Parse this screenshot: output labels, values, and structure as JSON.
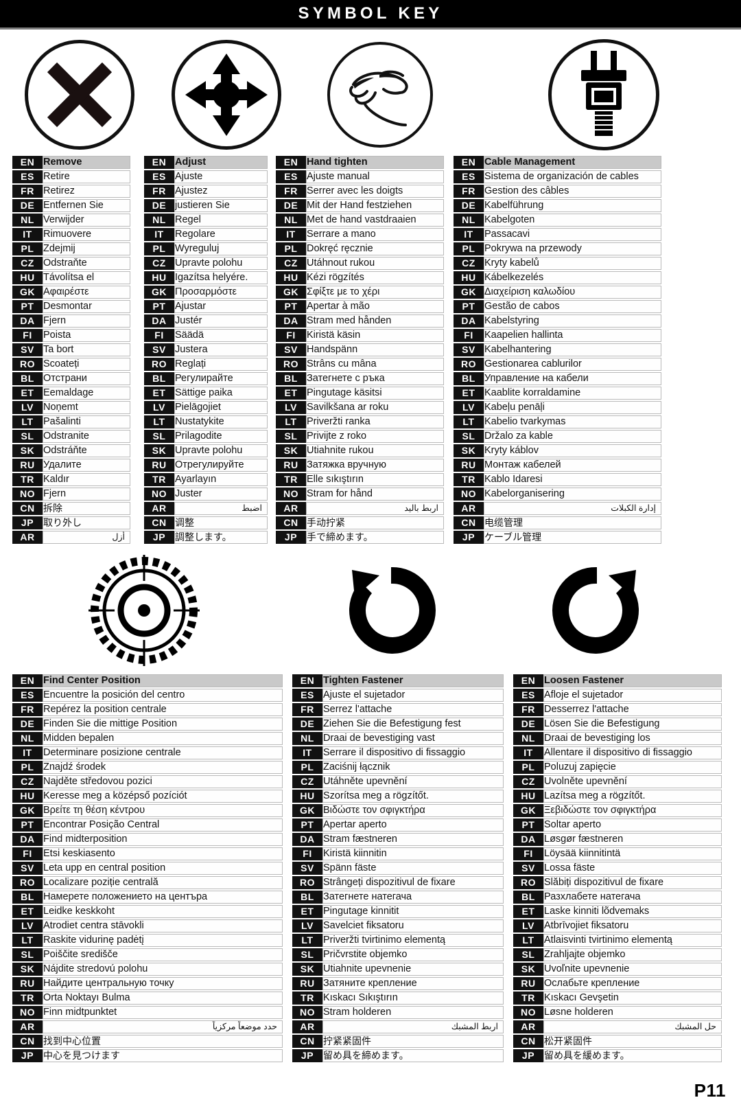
{
  "header": {
    "title": "SYMBOL KEY"
  },
  "footer": {
    "page_number": "P11"
  },
  "icons": {
    "top": [
      {
        "name": "x-cross-icon",
        "meaning": "Remove"
      },
      {
        "name": "four-way-arrows-icon",
        "meaning": "Adjust"
      },
      {
        "name": "hand-pinch-icon",
        "meaning": "Hand tighten"
      },
      {
        "name": "power-plug-icon",
        "meaning": "Cable Management"
      }
    ],
    "bottom": [
      {
        "name": "crosshair-target-icon",
        "meaning": "Find Center Position"
      },
      {
        "name": "clockwise-rotation-arrow-icon",
        "meaning": "Tighten Fastener"
      },
      {
        "name": "counterclockwise-rotation-arrow-icon",
        "meaning": "Loosen Fastener"
      }
    ]
  },
  "tables": {
    "remove": {
      "title": "Remove",
      "rows": [
        {
          "code": "EN",
          "text": "Remove"
        },
        {
          "code": "ES",
          "text": "Retire"
        },
        {
          "code": "FR",
          "text": "Retirez"
        },
        {
          "code": "DE",
          "text": "Entfernen Sie"
        },
        {
          "code": "NL",
          "text": "Verwijder"
        },
        {
          "code": "IT",
          "text": "Rimuovere"
        },
        {
          "code": "PL",
          "text": "Zdejmij"
        },
        {
          "code": "CZ",
          "text": "Odstraňte"
        },
        {
          "code": "HU",
          "text": "Távolítsa el"
        },
        {
          "code": "GK",
          "text": "Αφαιρέστε"
        },
        {
          "code": "PT",
          "text": "Desmontar"
        },
        {
          "code": "DA",
          "text": "Fjern"
        },
        {
          "code": "FI",
          "text": "Poista"
        },
        {
          "code": "SV",
          "text": "Ta bort"
        },
        {
          "code": "RO",
          "text": "Scoateți"
        },
        {
          "code": "BL",
          "text": "Отстрани"
        },
        {
          "code": "ET",
          "text": "Eemaldage"
        },
        {
          "code": "LV",
          "text": "Noņemt"
        },
        {
          "code": "LT",
          "text": "Pašalinti"
        },
        {
          "code": "SL",
          "text": "Odstranite"
        },
        {
          "code": "SK",
          "text": "Odstráňte"
        },
        {
          "code": "RU",
          "text": "Удалите"
        },
        {
          "code": "TR",
          "text": "Kaldır"
        },
        {
          "code": "NO",
          "text": "Fjern"
        },
        {
          "code": "CN",
          "text": "拆除"
        },
        {
          "code": "JP",
          "text": "取り外し"
        },
        {
          "code": "AR",
          "text": "أزل"
        }
      ]
    },
    "adjust": {
      "title": "Adjust",
      "rows": [
        {
          "code": "EN",
          "text": "Adjust"
        },
        {
          "code": "ES",
          "text": "Ajuste"
        },
        {
          "code": "FR",
          "text": "Ajustez"
        },
        {
          "code": "DE",
          "text": "justieren Sie"
        },
        {
          "code": "NL",
          "text": "Regel"
        },
        {
          "code": "IT",
          "text": "Regolare"
        },
        {
          "code": "PL",
          "text": "Wyreguluj"
        },
        {
          "code": "CZ",
          "text": "Upravte polohu"
        },
        {
          "code": "HU",
          "text": "Igazítsa helyére."
        },
        {
          "code": "GK",
          "text": "Προσαρμόστε"
        },
        {
          "code": "PT",
          "text": "Ajustar"
        },
        {
          "code": "DA",
          "text": "Justér"
        },
        {
          "code": "FI",
          "text": "Säädä"
        },
        {
          "code": "SV",
          "text": "Justera"
        },
        {
          "code": "RO",
          "text": "Reglați"
        },
        {
          "code": "BL",
          "text": "Регулирайте"
        },
        {
          "code": "ET",
          "text": "Sättige paika"
        },
        {
          "code": "LV",
          "text": "Pielāgojiet"
        },
        {
          "code": "LT",
          "text": "Nustatykite"
        },
        {
          "code": "SL",
          "text": "Prilagodite"
        },
        {
          "code": "SK",
          "text": "Upravte polohu"
        },
        {
          "code": "RU",
          "text": "Отрегулируйте"
        },
        {
          "code": "TR",
          "text": "Ayarlayın"
        },
        {
          "code": "NO",
          "text": "Juster"
        },
        {
          "code": "AR",
          "text": "اضبط"
        },
        {
          "code": "CN",
          "text": "调整"
        },
        {
          "code": "JP",
          "text": "調整します。"
        }
      ]
    },
    "hand_tighten": {
      "title": "Hand tighten",
      "rows": [
        {
          "code": "EN",
          "text": "Hand tighten"
        },
        {
          "code": "ES",
          "text": "Ajuste manual"
        },
        {
          "code": "FR",
          "text": "Serrer avec les doigts"
        },
        {
          "code": "DE",
          "text": "Mit der Hand festziehen"
        },
        {
          "code": "NL",
          "text": "Met de hand vastdraaien"
        },
        {
          "code": "IT",
          "text": "Serrare a mano"
        },
        {
          "code": "PL",
          "text": "Dokręć ręcznie"
        },
        {
          "code": "CZ",
          "text": "Utáhnout rukou"
        },
        {
          "code": "HU",
          "text": "Kézi rögzítés"
        },
        {
          "code": "GK",
          "text": "Σφίξτε με το χέρι"
        },
        {
          "code": "PT",
          "text": "Apertar à mão"
        },
        {
          "code": "DA",
          "text": "Stram med hånden"
        },
        {
          "code": "FI",
          "text": "Kiristä käsin"
        },
        {
          "code": "SV",
          "text": "Handspänn"
        },
        {
          "code": "RO",
          "text": "Strâns cu mâna"
        },
        {
          "code": "BL",
          "text": "Затегнете с ръка"
        },
        {
          "code": "ET",
          "text": "Pingutage käsitsi"
        },
        {
          "code": "LV",
          "text": "Savilkšana ar roku"
        },
        {
          "code": "LT",
          "text": "Priveržti ranka"
        },
        {
          "code": "SL",
          "text": "Privijte z roko"
        },
        {
          "code": "SK",
          "text": "Utiahnite rukou"
        },
        {
          "code": "RU",
          "text": "Затяжка вручную"
        },
        {
          "code": "TR",
          "text": "Elle sıkıştırın"
        },
        {
          "code": "NO",
          "text": "Stram for hånd"
        },
        {
          "code": "AR",
          "text": "اربط باليد"
        },
        {
          "code": "CN",
          "text": "手动拧紧"
        },
        {
          "code": "JP",
          "text": "手で締めます。"
        }
      ]
    },
    "cable_management": {
      "title": "Cable Management",
      "rows": [
        {
          "code": "EN",
          "text": "Cable Management"
        },
        {
          "code": "ES",
          "text": "Sistema de organización de cables"
        },
        {
          "code": "FR",
          "text": "Gestion des câbles"
        },
        {
          "code": "DE",
          "text": "Kabelführung"
        },
        {
          "code": "NL",
          "text": "Kabelgoten"
        },
        {
          "code": "IT",
          "text": "Passacavi"
        },
        {
          "code": "PL",
          "text": "Pokrywa na przewody"
        },
        {
          "code": "CZ",
          "text": "Kryty kabelů"
        },
        {
          "code": "HU",
          "text": "Kábelkezelés"
        },
        {
          "code": "GK",
          "text": "Διαχείριση καλωδίου"
        },
        {
          "code": "PT",
          "text": "Gestão de cabos"
        },
        {
          "code": "DA",
          "text": "Kabelstyring"
        },
        {
          "code": "FI",
          "text": "Kaapelien hallinta"
        },
        {
          "code": "SV",
          "text": "Kabelhantering"
        },
        {
          "code": "RO",
          "text": "Gestionarea cablurilor"
        },
        {
          "code": "BL",
          "text": "Управление на кабели"
        },
        {
          "code": "ET",
          "text": "Kaablite korraldamine"
        },
        {
          "code": "LV",
          "text": "Kabeļu penāļi"
        },
        {
          "code": "LT",
          "text": "Kabelio tvarkymas"
        },
        {
          "code": "SL",
          "text": "Držalo za kable"
        },
        {
          "code": "SK",
          "text": "Kryty káblov"
        },
        {
          "code": "RU",
          "text": "Монтаж кабелей"
        },
        {
          "code": "TR",
          "text": "Kablo İdaresi"
        },
        {
          "code": "NO",
          "text": "Kabelorganisering"
        },
        {
          "code": "AR",
          "text": "إدارة الكبلات"
        },
        {
          "code": "CN",
          "text": "电缆管理"
        },
        {
          "code": "JP",
          "text": "ケーブル管理"
        }
      ]
    },
    "find_center": {
      "title": "Find Center Position",
      "rows": [
        {
          "code": "EN",
          "text": "Find Center Position"
        },
        {
          "code": "ES",
          "text": "Encuentre la posición del centro"
        },
        {
          "code": "FR",
          "text": "Repérez la position centrale"
        },
        {
          "code": "DE",
          "text": "Finden Sie die mittige Position"
        },
        {
          "code": "NL",
          "text": "Midden bepalen"
        },
        {
          "code": "IT",
          "text": "Determinare posizione centrale"
        },
        {
          "code": "PL",
          "text": "Znajdź środek"
        },
        {
          "code": "CZ",
          "text": "Najděte středovou pozici"
        },
        {
          "code": "HU",
          "text": "Keresse meg a középső pozíciót"
        },
        {
          "code": "GK",
          "text": "Βρείτε τη θέση κέντρου"
        },
        {
          "code": "PT",
          "text": "Encontrar Posição Central"
        },
        {
          "code": "DA",
          "text": "Find midterposition"
        },
        {
          "code": "FI",
          "text": "Etsi keskiasento"
        },
        {
          "code": "SV",
          "text": "Leta upp en central position"
        },
        {
          "code": "RO",
          "text": " Localizare poziție centrală"
        },
        {
          "code": "BL",
          "text": "Намерете положението на центъра"
        },
        {
          "code": "ET",
          "text": "Leidke keskkoht"
        },
        {
          "code": "LV",
          "text": "Atrodiet centra stāvokli"
        },
        {
          "code": "LT",
          "text": "Raskite vidurinę padėtį"
        },
        {
          "code": "SL",
          "text": "Poiščite središče"
        },
        {
          "code": "SK",
          "text": "Nájdite stredovú polohu"
        },
        {
          "code": "RU",
          "text": "Найдите центральную точку"
        },
        {
          "code": "TR",
          "text": "Orta Noktayı Bulma"
        },
        {
          "code": "NO",
          "text": "Finn midtpunktet"
        },
        {
          "code": "AR",
          "text": "حدد موضعاً مركزياً"
        },
        {
          "code": "CN",
          "text": "找到中心位置"
        },
        {
          "code": "JP",
          "text": "中心を見つけます"
        }
      ]
    },
    "tighten_fastener": {
      "title": "Tighten Fastener",
      "rows": [
        {
          "code": "EN",
          "text": "Tighten Fastener"
        },
        {
          "code": "ES",
          "text": "Ajuste el sujetador"
        },
        {
          "code": "FR",
          "text": "Serrez l'attache"
        },
        {
          "code": "DE",
          "text": "Ziehen Sie die Befestigung fest"
        },
        {
          "code": "NL",
          "text": "Draai de bevestiging vast"
        },
        {
          "code": "IT",
          "text": "Serrare il dispositivo di fissaggio"
        },
        {
          "code": "PL",
          "text": "Zaciśnij łącznik"
        },
        {
          "code": "CZ",
          "text": "Utáhněte upevnění"
        },
        {
          "code": "HU",
          "text": "Szorítsa meg a rögzítőt."
        },
        {
          "code": "GK",
          "text": "Βιδώστε τον σφιγκτήρα"
        },
        {
          "code": "PT",
          "text": "Apertar aperto"
        },
        {
          "code": "DA",
          "text": "Stram fæstneren"
        },
        {
          "code": "FI",
          "text": "Kiristä kiinnitin"
        },
        {
          "code": "SV",
          "text": "Spänn fäste"
        },
        {
          "code": "RO",
          "text": "Strângeți dispozitivul de fixare"
        },
        {
          "code": "BL",
          "text": "Затегнете натегача"
        },
        {
          "code": "ET",
          "text": "Pingutage kinnitit"
        },
        {
          "code": "LV",
          "text": "Savelciet fiksatoru"
        },
        {
          "code": "LT",
          "text": "Priveržti tvirtinimo elementą"
        },
        {
          "code": "SL",
          "text": "Pričvrstite objemko"
        },
        {
          "code": "SK",
          "text": "Utiahnite upevnenie"
        },
        {
          "code": "RU",
          "text": "Затяните крепление"
        },
        {
          "code": "TR",
          "text": "Kıskacı Sıkıştırın"
        },
        {
          "code": "NO",
          "text": "Stram holderen"
        },
        {
          "code": "AR",
          "text": "اربط المشبك"
        },
        {
          "code": "CN",
          "text": "拧紧紧固件"
        },
        {
          "code": "JP",
          "text": "留め具を締めます。"
        }
      ]
    },
    "loosen_fastener": {
      "title": "Loosen Fastener",
      "rows": [
        {
          "code": "EN",
          "text": "Loosen Fastener"
        },
        {
          "code": "ES",
          "text": "Afloje el sujetador"
        },
        {
          "code": "FR",
          "text": "Desserrez l'attache"
        },
        {
          "code": "DE",
          "text": "Lösen Sie die Befestigung"
        },
        {
          "code": "NL",
          "text": "Draai de bevestiging los"
        },
        {
          "code": "IT",
          "text": "Allentare il dispositivo di fissaggio"
        },
        {
          "code": "PL",
          "text": "Poluzuj zapięcie"
        },
        {
          "code": "CZ",
          "text": "Uvolněte upevnění"
        },
        {
          "code": "HU",
          "text": "Lazítsa meg a rögzítőt."
        },
        {
          "code": "GK",
          "text": "Ξεβιδώστε τον σφιγκτήρα"
        },
        {
          "code": "PT",
          "text": "Soltar aperto"
        },
        {
          "code": "DA",
          "text": "Løsgør fæstneren"
        },
        {
          "code": "FI",
          "text": "Löysää kiinnitintä"
        },
        {
          "code": "SV",
          "text": "Lossa fäste"
        },
        {
          "code": "RO",
          "text": "Slăbiți dispozitivul de fixare"
        },
        {
          "code": "BL",
          "text": "Разхлабете натегача"
        },
        {
          "code": "ET",
          "text": "Laske kinniti lõdvemaks"
        },
        {
          "code": "LV",
          "text": "Atbrīvojiet fiksatoru"
        },
        {
          "code": "LT",
          "text": "Atlaisvinti tvirtinimo elementą"
        },
        {
          "code": "SL",
          "text": "Zrahljajte objemko"
        },
        {
          "code": "SK",
          "text": "Uvoľnite upevnenie"
        },
        {
          "code": "RU",
          "text": "Ослабьте крепление"
        },
        {
          "code": "TR",
          "text": "Kıskacı Gevşetin"
        },
        {
          "code": "NO",
          "text": "Løsne holderen"
        },
        {
          "code": "AR",
          "text": "حل المشبك"
        },
        {
          "code": "CN",
          "text": "松开紧固件"
        },
        {
          "code": "JP",
          "text": "留め具を緩めます。"
        }
      ]
    }
  }
}
